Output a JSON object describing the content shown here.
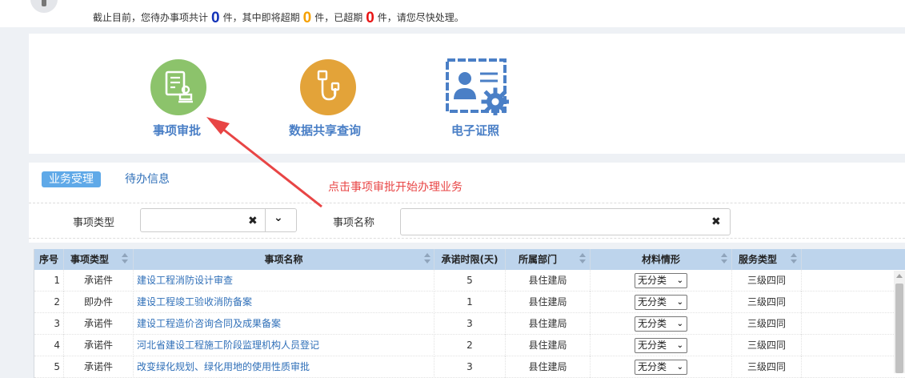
{
  "summary": {
    "prefix": "截止目前，您待办事项共计",
    "pending_count": "0",
    "mid1": "件，其中即将超期",
    "near_due_count": "0",
    "mid2": "件，已超期",
    "overdue_count": "0",
    "suffix": "件，请您尽快处理。"
  },
  "apps": [
    {
      "label": "事项审批",
      "icon": "document-stamp-icon",
      "color": "#8cc36b"
    },
    {
      "label": "数据共享查询",
      "icon": "usb-plug-icon",
      "color": "#e3a339"
    },
    {
      "label": "电子证照",
      "icon": "id-card-gear-icon",
      "color": "#4a7fc6"
    }
  ],
  "annotation": {
    "text": "点击事项审批开始办理业务",
    "color": "#e84545"
  },
  "tabs": {
    "active": "业务受理",
    "other": "待办信息"
  },
  "filters": {
    "type_label": "事项类型",
    "type_value": "",
    "name_label": "事项名称",
    "name_value": ""
  },
  "table": {
    "headers": [
      "序号",
      "事项类型",
      "事项名称",
      "承诺时限(天)",
      "所属部门",
      "材料情形",
      "服务类型"
    ],
    "rows": [
      {
        "no": "1",
        "type": "承诺件",
        "name": "建设工程消防设计审查",
        "days": "5",
        "dept": "县住建局",
        "material": "无分类",
        "service": "三级四同"
      },
      {
        "no": "2",
        "type": "即办件",
        "name": "建设工程竣工验收消防备案",
        "days": "1",
        "dept": "县住建局",
        "material": "无分类",
        "service": "三级四同"
      },
      {
        "no": "3",
        "type": "承诺件",
        "name": "建设工程造价咨询合同及成果备案",
        "days": "3",
        "dept": "县住建局",
        "material": "无分类",
        "service": "三级四同"
      },
      {
        "no": "4",
        "type": "承诺件",
        "name": "河北省建设工程施工阶段监理机构人员登记",
        "days": "2",
        "dept": "县住建局",
        "material": "无分类",
        "service": "三级四同"
      },
      {
        "no": "5",
        "type": "承诺件",
        "name": "改变绿化规划、绿化用地的使用性质审批",
        "days": "3",
        "dept": "县住建局",
        "material": "无分类",
        "service": "三级四同"
      }
    ]
  }
}
